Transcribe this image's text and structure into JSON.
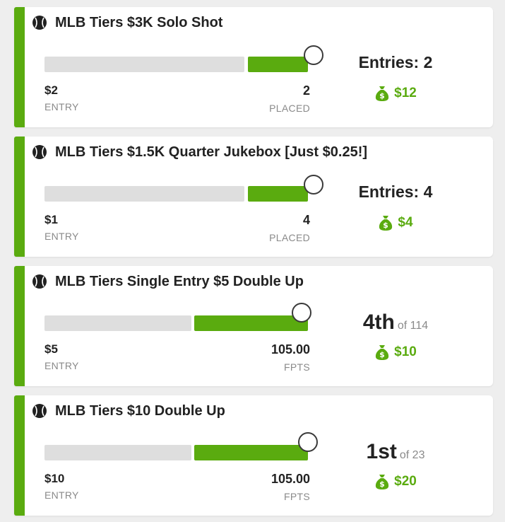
{
  "colors": {
    "accent": "#5aab0f",
    "track": "#dedede"
  },
  "contests": [
    {
      "title": "MLB Tiers $3K Solo Shot",
      "entry_fee": "$2",
      "entry_label": "ENTRY",
      "stat_value": "2",
      "stat_label": "PLACED",
      "entries_text": "Entries: 2",
      "prize": "$12",
      "progress": 0.23
    },
    {
      "title": "MLB Tiers $1.5K Quarter Jukebox [Just $0.25!]",
      "entry_fee": "$1",
      "entry_label": "ENTRY",
      "stat_value": "4",
      "stat_label": "PLACED",
      "entries_text": "Entries: 4",
      "prize": "$4",
      "progress": 0.23
    },
    {
      "title": "MLB Tiers Single Entry $5 Double Up",
      "entry_fee": "$5",
      "entry_label": "ENTRY",
      "stat_value": "105.00",
      "stat_label": "FPTS",
      "rank": "4th",
      "rank_of": "of 114",
      "prize": "$10",
      "progress": 0.43
    },
    {
      "title": "MLB Tiers $10 Double Up",
      "entry_fee": "$10",
      "entry_label": "ENTRY",
      "stat_value": "105.00",
      "stat_label": "FPTS",
      "rank": "1st",
      "rank_of": "of 23",
      "prize": "$20",
      "progress": 0.43
    }
  ]
}
